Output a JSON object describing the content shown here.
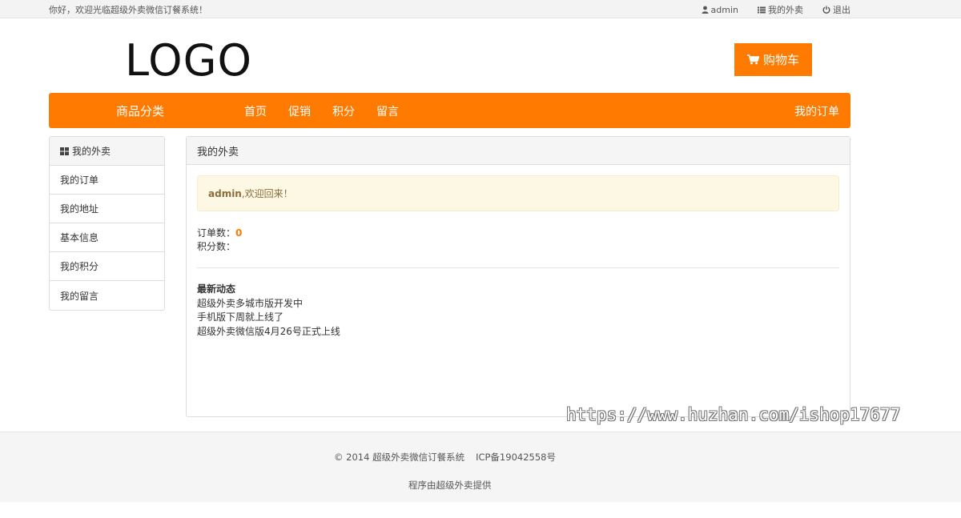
{
  "topbar": {
    "greeting": "你好，欢迎光临超级外卖微信订餐系统！",
    "links": [
      {
        "icon": "user-icon",
        "label": "admin"
      },
      {
        "icon": "list-icon",
        "label": "我的外卖"
      },
      {
        "icon": "power-icon",
        "label": "退出"
      }
    ]
  },
  "header": {
    "logo": "LOGO",
    "cart_label": "购物车",
    "cart_icon": "cart-icon"
  },
  "navbar": {
    "category": "商品分类",
    "items": [
      "首页",
      "促销",
      "积分",
      "留言"
    ],
    "orders": "我的订单"
  },
  "sidebar": {
    "title": "我的外卖",
    "title_icon": "grid-icon",
    "items": [
      "我的订单",
      "我的地址",
      "基本信息",
      "我的积分",
      "我的留言"
    ]
  },
  "panel": {
    "title": "我的外卖",
    "alert_user": "admin",
    "alert_text": ",欢迎回来！",
    "order_count_label": "订单数：",
    "order_count": "0",
    "points_label": "积分数：",
    "news_title": "最新动态",
    "news": [
      "超级外卖多城市版开发中",
      "手机版下周就上线了",
      "超级外卖微信版4月26号正式上线"
    ]
  },
  "watermark": "https://www.huzhan.com/ishop17677",
  "footer": {
    "copyright": "© 2014 超级外卖微信订餐系统",
    "icp": "ICP备19042558号",
    "powered": "程序由超级外卖提供"
  },
  "colors": {
    "accent": "#ff7a00",
    "alert_bg": "#fcf8e3",
    "alert_text": "#8a6d3b"
  }
}
